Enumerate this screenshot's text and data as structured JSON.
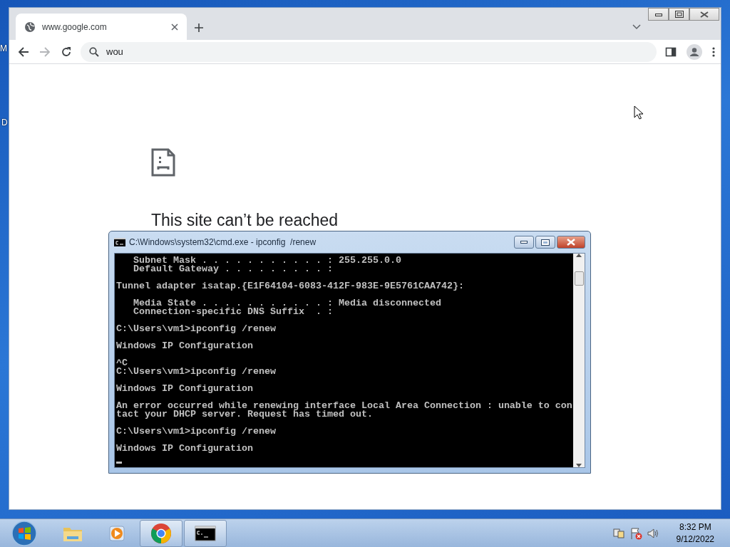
{
  "desktop": {
    "icon_labels": [
      "M",
      "D"
    ]
  },
  "browser": {
    "tabs": [
      {
        "title": "www.google.com",
        "selected": true
      }
    ],
    "toolbar": {
      "back_disabled": false,
      "forward_disabled": true
    },
    "address": {
      "value": "wou"
    },
    "page": {
      "heading": "This site can’t be reached"
    }
  },
  "console": {
    "title": "C:\\Windows\\system32\\cmd.exe - ipconfig  /renew",
    "paragraphs": [
      [
        "   Subnet Mask . . . . . . . . . . . : 255.255.0.0",
        "   Default Gateway . . . . . . . . . :"
      ],
      [
        "Tunnel adapter isatap.{E1F64104-6083-412F-983E-9E5761CAA742}:"
      ],
      [
        "   Media State . . . . . . . . . . . : Media disconnected",
        "   Connection-specific DNS Suffix  . :"
      ],
      [
        "C:\\Users\\vm1>ipconfig /renew"
      ],
      [
        "Windows IP Configuration"
      ],
      [
        "^C",
        "C:\\Users\\vm1>ipconfig /renew"
      ],
      [
        "Windows IP Configuration"
      ],
      [
        "An error occurred while renewing interface Local Area Connection : unable to con",
        "tact your DHCP server. Request has timed out."
      ],
      [
        "C:\\Users\\vm1>ipconfig /renew"
      ],
      [
        "Windows IP Configuration"
      ]
    ]
  },
  "taskbar": {
    "items": [
      {
        "kind": "folder",
        "running": false
      },
      {
        "kind": "media",
        "running": false
      },
      {
        "kind": "chrome",
        "running": true
      },
      {
        "kind": "console",
        "running": true
      }
    ],
    "clock": {
      "time": "8:32 PM",
      "date": "9/12/2022"
    }
  }
}
